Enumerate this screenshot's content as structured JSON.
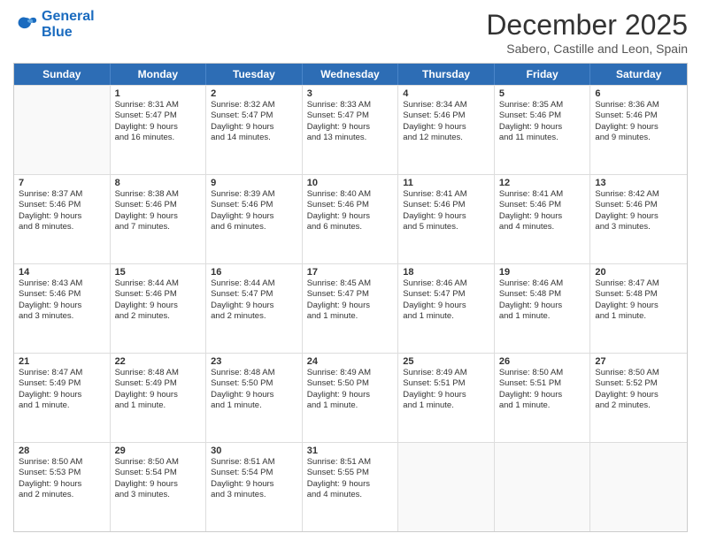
{
  "logo": {
    "line1": "General",
    "line2": "Blue"
  },
  "title": "December 2025",
  "subtitle": "Sabero, Castille and Leon, Spain",
  "header": {
    "days": [
      "Sunday",
      "Monday",
      "Tuesday",
      "Wednesday",
      "Thursday",
      "Friday",
      "Saturday"
    ]
  },
  "rows": [
    [
      {
        "empty": true
      },
      {
        "day": "1",
        "sunrise": "Sunrise: 8:31 AM",
        "sunset": "Sunset: 5:47 PM",
        "daylight": "Daylight: 9 hours",
        "daylight2": "and 16 minutes."
      },
      {
        "day": "2",
        "sunrise": "Sunrise: 8:32 AM",
        "sunset": "Sunset: 5:47 PM",
        "daylight": "Daylight: 9 hours",
        "daylight2": "and 14 minutes."
      },
      {
        "day": "3",
        "sunrise": "Sunrise: 8:33 AM",
        "sunset": "Sunset: 5:47 PM",
        "daylight": "Daylight: 9 hours",
        "daylight2": "and 13 minutes."
      },
      {
        "day": "4",
        "sunrise": "Sunrise: 8:34 AM",
        "sunset": "Sunset: 5:46 PM",
        "daylight": "Daylight: 9 hours",
        "daylight2": "and 12 minutes."
      },
      {
        "day": "5",
        "sunrise": "Sunrise: 8:35 AM",
        "sunset": "Sunset: 5:46 PM",
        "daylight": "Daylight: 9 hours",
        "daylight2": "and 11 minutes."
      },
      {
        "day": "6",
        "sunrise": "Sunrise: 8:36 AM",
        "sunset": "Sunset: 5:46 PM",
        "daylight": "Daylight: 9 hours",
        "daylight2": "and 9 minutes."
      }
    ],
    [
      {
        "day": "7",
        "sunrise": "Sunrise: 8:37 AM",
        "sunset": "Sunset: 5:46 PM",
        "daylight": "Daylight: 9 hours",
        "daylight2": "and 8 minutes."
      },
      {
        "day": "8",
        "sunrise": "Sunrise: 8:38 AM",
        "sunset": "Sunset: 5:46 PM",
        "daylight": "Daylight: 9 hours",
        "daylight2": "and 7 minutes."
      },
      {
        "day": "9",
        "sunrise": "Sunrise: 8:39 AM",
        "sunset": "Sunset: 5:46 PM",
        "daylight": "Daylight: 9 hours",
        "daylight2": "and 6 minutes."
      },
      {
        "day": "10",
        "sunrise": "Sunrise: 8:40 AM",
        "sunset": "Sunset: 5:46 PM",
        "daylight": "Daylight: 9 hours",
        "daylight2": "and 6 minutes."
      },
      {
        "day": "11",
        "sunrise": "Sunrise: 8:41 AM",
        "sunset": "Sunset: 5:46 PM",
        "daylight": "Daylight: 9 hours",
        "daylight2": "and 5 minutes."
      },
      {
        "day": "12",
        "sunrise": "Sunrise: 8:41 AM",
        "sunset": "Sunset: 5:46 PM",
        "daylight": "Daylight: 9 hours",
        "daylight2": "and 4 minutes."
      },
      {
        "day": "13",
        "sunrise": "Sunrise: 8:42 AM",
        "sunset": "Sunset: 5:46 PM",
        "daylight": "Daylight: 9 hours",
        "daylight2": "and 3 minutes."
      }
    ],
    [
      {
        "day": "14",
        "sunrise": "Sunrise: 8:43 AM",
        "sunset": "Sunset: 5:46 PM",
        "daylight": "Daylight: 9 hours",
        "daylight2": "and 3 minutes."
      },
      {
        "day": "15",
        "sunrise": "Sunrise: 8:44 AM",
        "sunset": "Sunset: 5:46 PM",
        "daylight": "Daylight: 9 hours",
        "daylight2": "and 2 minutes."
      },
      {
        "day": "16",
        "sunrise": "Sunrise: 8:44 AM",
        "sunset": "Sunset: 5:47 PM",
        "daylight": "Daylight: 9 hours",
        "daylight2": "and 2 minutes."
      },
      {
        "day": "17",
        "sunrise": "Sunrise: 8:45 AM",
        "sunset": "Sunset: 5:47 PM",
        "daylight": "Daylight: 9 hours",
        "daylight2": "and 1 minute."
      },
      {
        "day": "18",
        "sunrise": "Sunrise: 8:46 AM",
        "sunset": "Sunset: 5:47 PM",
        "daylight": "Daylight: 9 hours",
        "daylight2": "and 1 minute."
      },
      {
        "day": "19",
        "sunrise": "Sunrise: 8:46 AM",
        "sunset": "Sunset: 5:48 PM",
        "daylight": "Daylight: 9 hours",
        "daylight2": "and 1 minute."
      },
      {
        "day": "20",
        "sunrise": "Sunrise: 8:47 AM",
        "sunset": "Sunset: 5:48 PM",
        "daylight": "Daylight: 9 hours",
        "daylight2": "and 1 minute."
      }
    ],
    [
      {
        "day": "21",
        "sunrise": "Sunrise: 8:47 AM",
        "sunset": "Sunset: 5:49 PM",
        "daylight": "Daylight: 9 hours",
        "daylight2": "and 1 minute."
      },
      {
        "day": "22",
        "sunrise": "Sunrise: 8:48 AM",
        "sunset": "Sunset: 5:49 PM",
        "daylight": "Daylight: 9 hours",
        "daylight2": "and 1 minute."
      },
      {
        "day": "23",
        "sunrise": "Sunrise: 8:48 AM",
        "sunset": "Sunset: 5:50 PM",
        "daylight": "Daylight: 9 hours",
        "daylight2": "and 1 minute."
      },
      {
        "day": "24",
        "sunrise": "Sunrise: 8:49 AM",
        "sunset": "Sunset: 5:50 PM",
        "daylight": "Daylight: 9 hours",
        "daylight2": "and 1 minute."
      },
      {
        "day": "25",
        "sunrise": "Sunrise: 8:49 AM",
        "sunset": "Sunset: 5:51 PM",
        "daylight": "Daylight: 9 hours",
        "daylight2": "and 1 minute."
      },
      {
        "day": "26",
        "sunrise": "Sunrise: 8:50 AM",
        "sunset": "Sunset: 5:51 PM",
        "daylight": "Daylight: 9 hours",
        "daylight2": "and 1 minute."
      },
      {
        "day": "27",
        "sunrise": "Sunrise: 8:50 AM",
        "sunset": "Sunset: 5:52 PM",
        "daylight": "Daylight: 9 hours",
        "daylight2": "and 2 minutes."
      }
    ],
    [
      {
        "day": "28",
        "sunrise": "Sunrise: 8:50 AM",
        "sunset": "Sunset: 5:53 PM",
        "daylight": "Daylight: 9 hours",
        "daylight2": "and 2 minutes."
      },
      {
        "day": "29",
        "sunrise": "Sunrise: 8:50 AM",
        "sunset": "Sunset: 5:54 PM",
        "daylight": "Daylight: 9 hours",
        "daylight2": "and 3 minutes."
      },
      {
        "day": "30",
        "sunrise": "Sunrise: 8:51 AM",
        "sunset": "Sunset: 5:54 PM",
        "daylight": "Daylight: 9 hours",
        "daylight2": "and 3 minutes."
      },
      {
        "day": "31",
        "sunrise": "Sunrise: 8:51 AM",
        "sunset": "Sunset: 5:55 PM",
        "daylight": "Daylight: 9 hours",
        "daylight2": "and 4 minutes."
      },
      {
        "empty": true
      },
      {
        "empty": true
      },
      {
        "empty": true
      }
    ]
  ]
}
